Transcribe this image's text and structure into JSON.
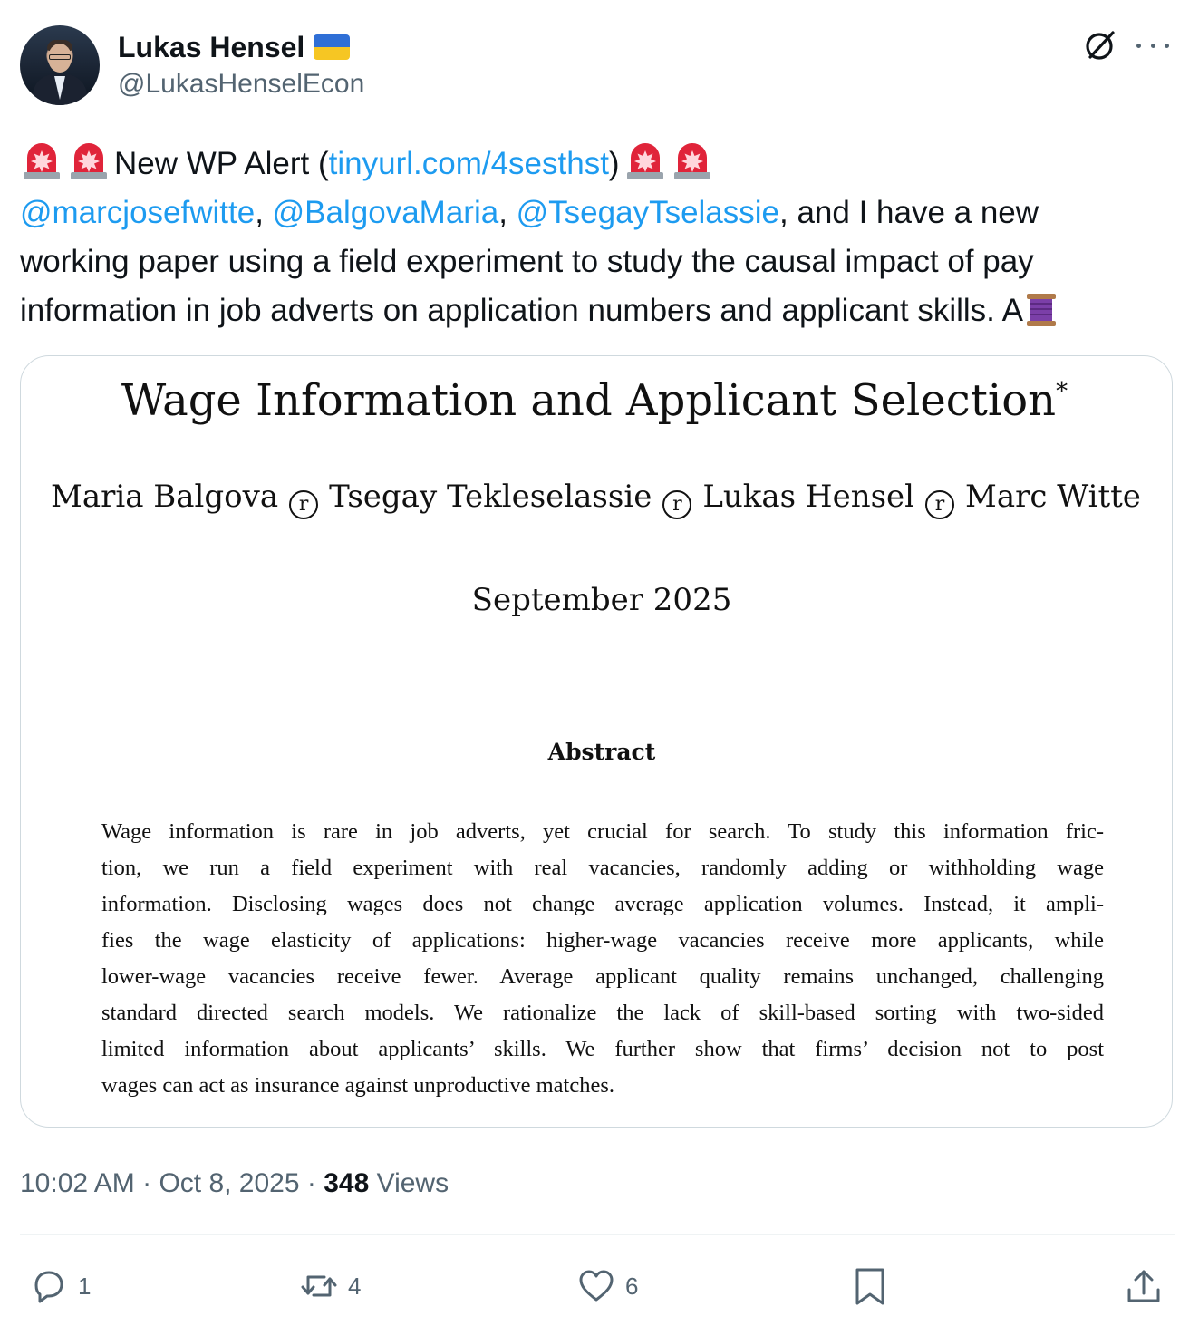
{
  "author": {
    "display_name": "Lukas Hensel",
    "handle": "@LukasHenselEcon",
    "flag_icon": "ukraine-flag-icon"
  },
  "header_icons": {
    "grok": "grok-icon",
    "more": "more-icon"
  },
  "tweet": {
    "line1_text": "New WP Alert (",
    "line1_link": "tinyurl.com/4sesthst",
    "line1_close": ")",
    "mention1": "@marcjosefwitte",
    "sep1": ", ",
    "mention2": "@BalgovaMaria",
    "sep2": ", ",
    "mention3": "@TsegayTselassie",
    "line2_tail": ", and I have a new",
    "line3": "working paper using a field experiment to study the causal impact of pay",
    "line4": "information in job adverts on application numbers and applicant skills. A",
    "emoji_siren": "police-siren-emoji",
    "emoji_thread": "thread-spool-emoji"
  },
  "paper": {
    "title": "Wage Information and Applicant Selection",
    "title_mark": "*",
    "authors": [
      "Maria Balgova",
      "Tsegay Tekleselassie",
      "Lukas Hensel",
      "Marc Witte"
    ],
    "separator": "r",
    "date": "September 2025",
    "abstract_heading": "Abstract",
    "abstract_lines": [
      "Wage information is rare in job adverts, yet crucial for search.  To study this information fric-",
      "tion, we run a field experiment with real vacancies, randomly adding or withholding wage",
      "information. Disclosing wages does not change average application volumes. Instead, it ampli-",
      "fies the wage elasticity of applications:  higher-wage vacancies receive more applicants, while",
      "lower-wage vacancies receive fewer. Average applicant quality remains unchanged, challenging",
      "standard directed search models. We rationalize the lack of skill-based sorting with two-sided",
      "limited information about applicants’ skills.  We further show that firms’ decision not to post",
      "wages can act as insurance against unproductive matches."
    ]
  },
  "meta": {
    "time": "10:02 AM",
    "dot1": " · ",
    "date": "Oct 8, 2025",
    "dot2": " · ",
    "views_count": "348",
    "views_label": " Views"
  },
  "actions": {
    "replies": "1",
    "reposts": "4",
    "likes": "6",
    "bookmark_icon": "bookmark-icon",
    "share_icon": "share-icon"
  },
  "colors": {
    "link": "#1d9bf0",
    "muted": "#536471",
    "text": "#0f1419",
    "border": "#cfd9de"
  }
}
